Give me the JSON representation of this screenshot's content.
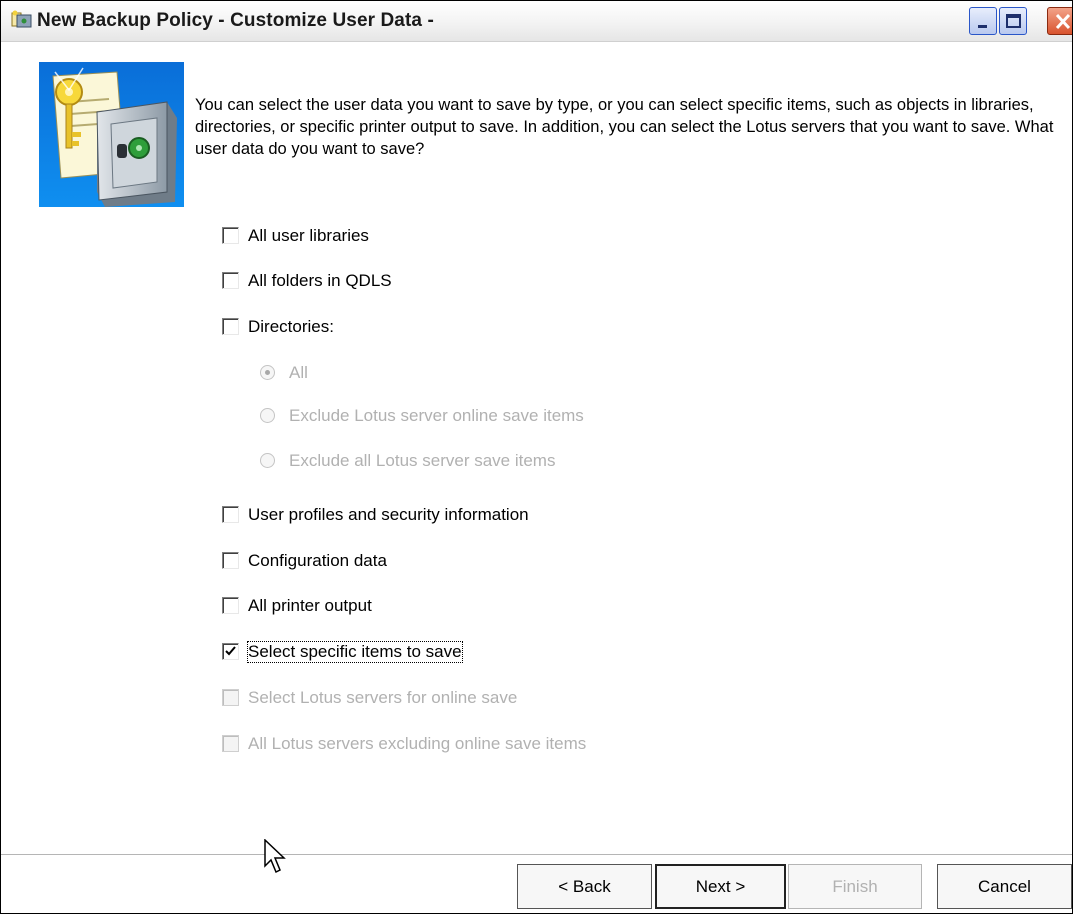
{
  "window": {
    "title": "New Backup Policy - Customize User Data -"
  },
  "intro_text": "You can select the user data you want to save by type, or you can select specific items, such as objects in libraries, directories, or specific printer output to save. In addition, you can select the Lotus servers that you want to save. What user data do you want to save?",
  "options": [
    {
      "label": "All user libraries",
      "checked": false,
      "enabled": true
    },
    {
      "label": "All folders in QDLS",
      "checked": false,
      "enabled": true
    },
    {
      "label": "Directories:",
      "checked": false,
      "enabled": true
    },
    {
      "label": "User profiles and security information",
      "checked": false,
      "enabled": true
    },
    {
      "label": "Configuration data",
      "checked": false,
      "enabled": true
    },
    {
      "label": "All printer output",
      "checked": false,
      "enabled": true
    },
    {
      "label": "Select specific items to save",
      "checked": true,
      "enabled": true
    },
    {
      "label": "Select Lotus servers for online save",
      "checked": false,
      "enabled": false
    },
    {
      "label": "All Lotus servers excluding online save items",
      "checked": false,
      "enabled": false
    }
  ],
  "directory_options": [
    {
      "label": "All",
      "selected": true,
      "enabled": false
    },
    {
      "label": "Exclude Lotus server online save items",
      "selected": false,
      "enabled": false
    },
    {
      "label": "Exclude all Lotus server save items",
      "selected": false,
      "enabled": false
    }
  ],
  "buttons": {
    "back": "< Back",
    "next": "Next >",
    "finish": "Finish",
    "cancel": "Cancel"
  },
  "icons": {
    "app": "backup-policy-icon",
    "wizard": "key-and-safe-icon"
  }
}
